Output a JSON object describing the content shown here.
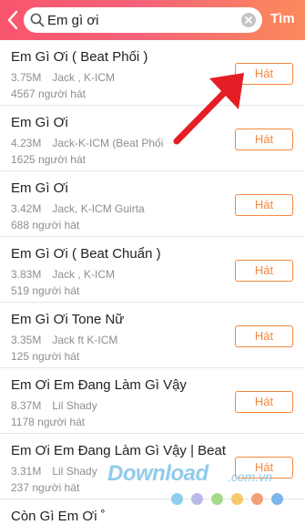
{
  "header": {
    "search_value": "Em gì ơi",
    "search_button_label": "Tìm",
    "icons": [
      "back-icon",
      "search-icon",
      "clear-icon"
    ],
    "gradient_colors": [
      "#f7556d",
      "#fb8a5a"
    ]
  },
  "accent_color": "#f4873f",
  "songs": [
    {
      "title": "Em Gì Ơi ( Beat Phối )",
      "size": "3.75M",
      "artist": "Jack , K-ICM",
      "listeners": "4567 người hát",
      "sing_label": "Hát"
    },
    {
      "title": "Em Gì Ơi",
      "size": "4.23M",
      "artist": "Jack-K-ICM (Beat Phối",
      "listeners": "1625 người hát",
      "sing_label": "Hát"
    },
    {
      "title": "Em Gì Ơi",
      "size": "3.42M",
      "artist": "Jack, K-ICM Guirta",
      "listeners": "688 người hát",
      "sing_label": "Hát"
    },
    {
      "title": "Em Gì Ơi ( Beat Chuẩn )",
      "size": "3.83M",
      "artist": "Jack , K-ICM",
      "listeners": "519 người hát",
      "sing_label": "Hát"
    },
    {
      "title": "Em Gì Ơi Tone Nữ",
      "size": "3.35M",
      "artist": "Jack ft K-ICM",
      "listeners": "125 người hát",
      "sing_label": "Hát"
    },
    {
      "title": "Em Ơi Em Đang Làm Gì Vậy",
      "size": "8.37M",
      "artist": "Lil Shady",
      "listeners": "1178 người hát",
      "sing_label": "Hát"
    },
    {
      "title": "Em Ơi Em Đang Làm Gì Vậy | Beat C...",
      "size": "3.31M",
      "artist": "Lil Shady",
      "listeners": "237 người hát",
      "sing_label": "Hát"
    },
    {
      "title": "Còn Gì Em Ơi ˚",
      "size": "",
      "artist": "",
      "listeners": "",
      "sing_label": ""
    }
  ],
  "watermark": {
    "text": "Download",
    "suffix": ".com.vn",
    "dot_colors": [
      "#8ecfee",
      "#b9b9e8",
      "#a7d98a",
      "#f6c96b",
      "#f3a07a",
      "#7ab6e8"
    ]
  },
  "annotation": {
    "arrow_color": "#e51d24"
  }
}
